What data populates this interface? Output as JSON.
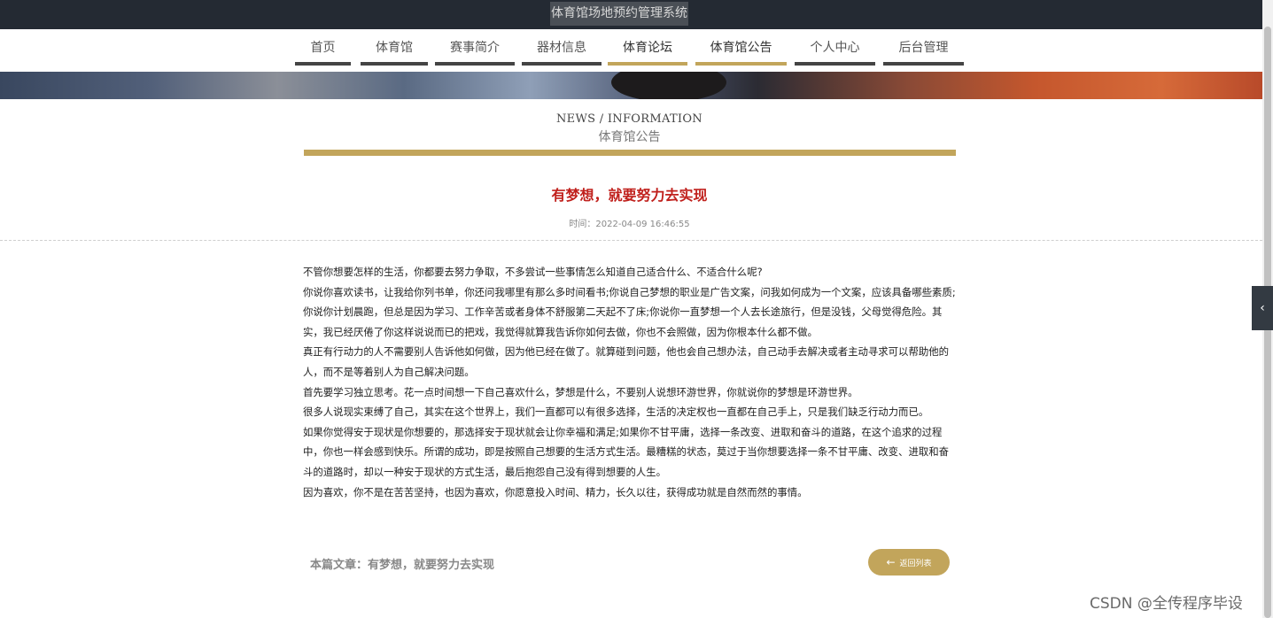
{
  "header": {
    "site_title": "体育馆场地预约管理系统"
  },
  "nav": {
    "items": [
      {
        "label": "首页"
      },
      {
        "label": "体育馆"
      },
      {
        "label": "赛事简介"
      },
      {
        "label": "器材信息"
      },
      {
        "label": "体育论坛"
      },
      {
        "label": "体育馆公告"
      },
      {
        "label": "个人中心"
      },
      {
        "label": "后台管理"
      }
    ]
  },
  "section": {
    "title_en": "NEWS / INFORMATION",
    "title_cn": "体育馆公告"
  },
  "article": {
    "title": "有梦想，就要努力去实现",
    "time_label": "时间：",
    "time_value": "2022-04-09 16:46:55",
    "paragraphs": [
      "不管你想要怎样的生活，你都要去努力争取，不多尝试一些事情怎么知道自己适合什么、不适合什么呢?",
      "你说你喜欢读书，让我给你列书单，你还问我哪里有那么多时间看书;你说自己梦想的职业是广告文案，问我如何成为一个文案，应该具备哪些素质;你说你计划晨跑，但总是因为学习、工作辛苦或者身体不舒服第二天起不了床;你说你一直梦想一个人去长途旅行，但是没钱，父母觉得危险。其实，我已经厌倦了你这样说说而已的把戏，我觉得就算我告诉你如何去做，你也不会照做，因为你根本什么都不做。",
      "真正有行动力的人不需要别人告诉他如何做，因为他已经在做了。就算碰到问题，他也会自己想办法，自己动手去解决或者主动寻求可以帮助他的人，而不是等着别人为自己解决问题。",
      "首先要学习独立思考。花一点时间想一下自己喜欢什么，梦想是什么，不要别人说想环游世界，你就说你的梦想是环游世界。",
      "很多人说现实束缚了自己，其实在这个世界上，我们一直都可以有很多选择，生活的决定权也一直都在自己手上，只是我们缺乏行动力而已。",
      "如果你觉得安于现状是你想要的，那选择安于现状就会让你幸福和满足;如果你不甘平庸，选择一条改变、进取和奋斗的道路，在这个追求的过程中，你也一样会感到快乐。所谓的成功，即是按照自己想要的生活方式生活。最糟糕的状态，莫过于当你想要选择一条不甘平庸、改变、进取和奋斗的道路时，却以一种安于现状的方式生活，最后抱怨自己没有得到想要的人生。",
      "因为喜欢，你不是在苦苦坚持，也因为喜欢，你愿意投入时间、精力，长久以往，获得成功就是自然而然的事情。"
    ],
    "footer_label": "本篇文章：",
    "footer_title": "有梦想，就要努力去实现",
    "back_label": "返回列表"
  },
  "side_toggle": "‹",
  "watermark": "CSDN @全传程序毕设",
  "colors": {
    "gold": "#c2a55b",
    "title_red": "#c0201c",
    "topbar": "#242a33"
  }
}
